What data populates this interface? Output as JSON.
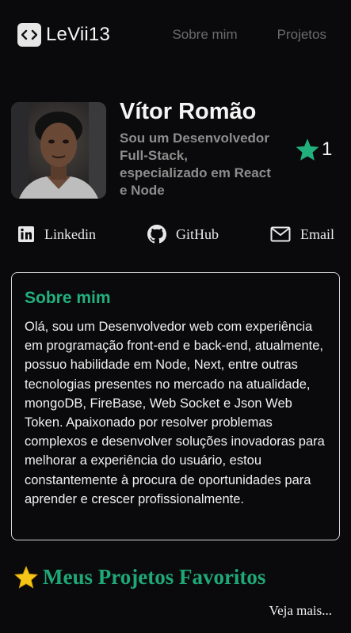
{
  "header": {
    "logo_text": "LeVii13",
    "nav": [
      {
        "label": "Sobre mim"
      },
      {
        "label": "Projetos"
      }
    ]
  },
  "profile": {
    "name": "Vítor Romão",
    "role": "Sou um Desenvolvedor Full-Stack, especializado em React e Node",
    "rating_count": "1"
  },
  "social": [
    {
      "label": "Linkedin",
      "icon": "linkedin-icon"
    },
    {
      "label": "GitHub",
      "icon": "github-icon"
    },
    {
      "label": "Email",
      "icon": "email-icon"
    }
  ],
  "about": {
    "title": "Sobre mim",
    "text": "Olá, sou um Desenvolvedor web com experiência em programação front-end e back-end, atualmente, possuo habilidade em Node, Next, entre outras tecnologias presentes no mercado na atualidade, mongoDB, FireBase, Web Socket e Json Web Token. Apaixonado por resolver problemas complexos e desenvolver soluções inovadoras para melhorar a experiência do usuário, estou constantemente à procura de oportunidades para aprender e crescer profissionalmente."
  },
  "favorites": {
    "title": "Meus Projetos Favoritos",
    "see_more": "Veja mais..."
  },
  "colors": {
    "background": "#0a0a0c",
    "accent": "#22b07d",
    "muted": "#8d8d8d",
    "star_fav": "#f5c518"
  }
}
